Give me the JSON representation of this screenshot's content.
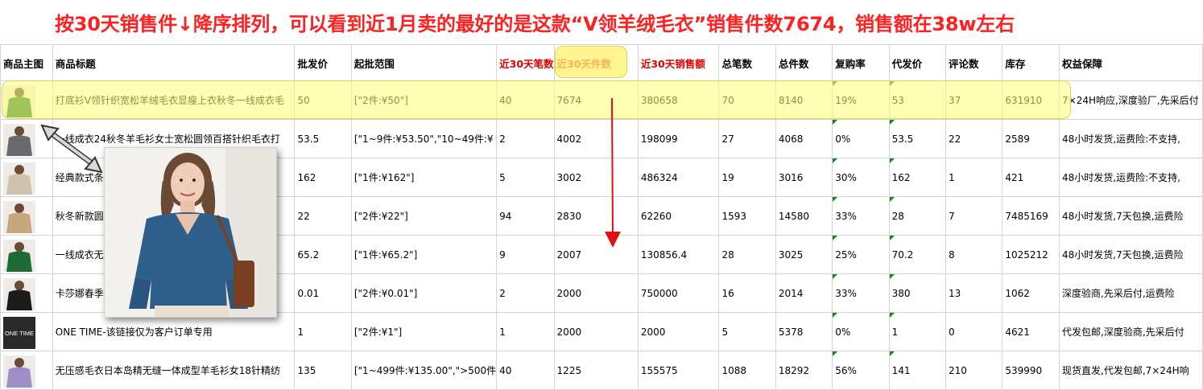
{
  "annotation": {
    "text": "按30天销售件↓降序排列，可以看到近1月卖的最好的是这款“V领羊绒毛衣”销售件数7674，销售额在38w左右",
    "color": "#ff2020"
  },
  "table": {
    "headers": [
      {
        "key": "img",
        "label": "商品主图",
        "red": false
      },
      {
        "key": "title",
        "label": "商品标题",
        "red": false
      },
      {
        "key": "price",
        "label": "批发价",
        "red": false
      },
      {
        "key": "range",
        "label": "起批范围",
        "red": false
      },
      {
        "key": "orders30",
        "label": "近30天笔数",
        "red": true
      },
      {
        "key": "pieces30",
        "label": "近30天件数",
        "red": true
      },
      {
        "key": "sales30",
        "label": "近30天销售额",
        "red": true
      },
      {
        "key": "orders",
        "label": "总笔数",
        "red": false
      },
      {
        "key": "pieces",
        "label": "总件数",
        "red": false
      },
      {
        "key": "repurchase",
        "label": "复购率",
        "red": false
      },
      {
        "key": "dropship",
        "label": "代发价",
        "red": false
      },
      {
        "key": "reviews",
        "label": "评论数",
        "red": false
      },
      {
        "key": "stock",
        "label": "库存",
        "red": false
      },
      {
        "key": "rights",
        "label": "权益保障",
        "red": false
      }
    ],
    "rows": [
      {
        "thumb": "green-sweater-thumb",
        "color": "#2f7a3a",
        "title": "打底衫V领针织宽松羊绒毛衣显瘦上衣秋冬一线成衣毛",
        "price": "50",
        "range": "[\"2件:¥50\"]",
        "orders30": "40",
        "pieces30": "7674",
        "sales30": "380658",
        "orders": "70",
        "pieces": "8140",
        "repurchase": "19%",
        "dropship": "53",
        "reviews": "37",
        "stock": "631910",
        "rights": "7×24H响应,深度验厂,先采后付"
      },
      {
        "thumb": "grey-sweater-thumb",
        "color": "#6a6a6e",
        "title": "一线成衣24秋冬羊毛衫女士宽松圆领百搭针织毛衣打",
        "price": "53.5",
        "range": "[\"1~9件:¥53.50\",\"10~49件:¥",
        "orders30": "2",
        "pieces30": "4002",
        "sales30": "198099",
        "orders": "27",
        "pieces": "4068",
        "repurchase": "0%",
        "dropship": "53.5",
        "reviews": "22",
        "stock": "2589",
        "rights": "48小时发货,运费险:不支持,"
      },
      {
        "thumb": "beige-sweater-thumb",
        "color": "#cfc3b0",
        "title": "经典款式条纹圆领宽松百搭羊毛针织衫打底百搭毛",
        "price": "162",
        "range": "[\"1件:¥162\"]",
        "orders30": "5",
        "pieces30": "3002",
        "sales30": "486324",
        "orders": "19",
        "pieces": "3016",
        "repurchase": "30%",
        "dropship": "162",
        "reviews": "1",
        "stock": "421",
        "rights": "48小时发货,运费险:不支持,"
      },
      {
        "thumb": "tan-sweater-thumb",
        "color": "#c9a77e",
        "title": "秋冬新款圆领宽松羊毛针织毛衣女套头百搭纯色",
        "price": "22",
        "range": "[\"2件:¥22\"]",
        "orders30": "94",
        "pieces30": "2830",
        "sales30": "62260",
        "orders": "1593",
        "pieces": "14580",
        "repurchase": "33%",
        "dropship": "28",
        "reviews": "7",
        "stock": "7485169",
        "rights": "48小时发货,7天包换,运费险"
      },
      {
        "thumb": "green-knit-thumb",
        "color": "#1e6b36",
        "title": "一线成衣无缝一体成型针织羊毛衫女士宽松V领镂",
        "price": "65.2",
        "range": "[\"1件:¥65.2\"]",
        "orders30": "9",
        "pieces30": "2007",
        "sales30": "130856.4",
        "orders": "28",
        "pieces": "3025",
        "repurchase": "25%",
        "dropship": "70.2",
        "reviews": "8",
        "stock": "1025212",
        "rights": "48小时发货,7天包换,运费险"
      },
      {
        "thumb": "black-coat-thumb",
        "color": "#1b1b1b",
        "title": "卡莎娜春季新款女装圆领针织开衫毛衣羊毛丝拼",
        "price": "0.01",
        "range": "[\"2件:¥0.01\"]",
        "orders30": "2",
        "pieces30": "2000",
        "sales30": "750000",
        "orders": "16",
        "pieces": "2014",
        "repurchase": "33%",
        "dropship": "380",
        "reviews": "13",
        "stock": "1062",
        "rights": "深度验商,先采后付,运费险"
      },
      {
        "thumb": "one-time-logo-thumb",
        "color": "#2a2a2a",
        "title": "ONE TIME-该链接仅为客户订单专用",
        "price": "1",
        "range": "[\"2件:¥1\"]",
        "orders30": "1",
        "pieces30": "2000",
        "sales30": "2000",
        "orders": "5",
        "pieces": "5378",
        "repurchase": "0%",
        "dropship": "1",
        "reviews": "0",
        "stock": "4621",
        "rights": "代发包邮,深度验商,先采后付"
      },
      {
        "thumb": "purple-sweater-thumb",
        "color": "#a08ec8",
        "title": "无压感毛衣日本岛精无缝一体成型羊毛衫女18针精纺",
        "price": "135",
        "range": "[\"1~499件:¥135.00\",\">500件",
        "orders30": "40",
        "pieces30": "1225",
        "sales30": "155575",
        "orders": "1088",
        "pieces": "18292",
        "repurchase": "56%",
        "dropship": "141",
        "reviews": "210",
        "stock": "539990",
        "rights": "现货直发,代发包邮,7×24H响"
      }
    ]
  },
  "thumb_text": "ONE TIME",
  "overlay": {
    "name": "blue-vneck-sweater-photo",
    "sweater_color": "#2e5f8a"
  }
}
